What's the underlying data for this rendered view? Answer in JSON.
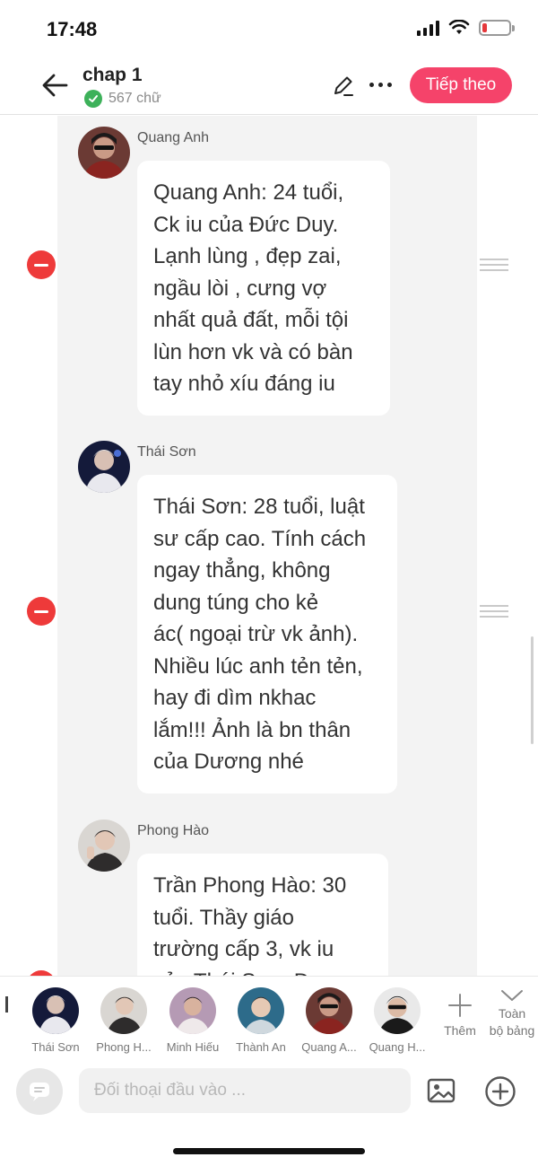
{
  "status_bar": {
    "time": "17:48",
    "battery_level": 0.15
  },
  "header": {
    "chapter_title": "chap 1",
    "word_count": "567 chữ",
    "next_label": "Tiếp theo",
    "accent_color": "#f5436a"
  },
  "messages": [
    {
      "speaker": "Quang Anh",
      "text": "Quang Anh: 24 tuổi,\nCk iu của Đức Duy.\nLạnh lùng , đẹp zai,\nngầu lòi , cưng vợ\nnhất quả đất, mỗi tội\nlùn hơn vk và có bàn\ntay nhỏ xíu đáng iu"
    },
    {
      "speaker": "Thái Sơn",
      "text": "Thái Sơn: 28 tuổi, luật\nsư cấp cao. Tính cách\nngay thẳng, không\ndung túng cho kẻ\nác( ngoại trừ vk ảnh).\nNhiều lúc anh tẻn tẻn,\nhay đi dìm nkhac\nlắm!!! Ảnh là bn thân\ncủa Dương nhé"
    },
    {
      "speaker": "Phong Hào",
      "text": "Trần Phong Hào: 30\ntuổi. Thầy giáo\ntrường cấp 3, vk iu\ncủa Thái Sơn. D..."
    }
  ],
  "characters": [
    {
      "label": "Thái Sơn"
    },
    {
      "label": "Phong H..."
    },
    {
      "label": "Minh Hiếu"
    },
    {
      "label": "Thành An"
    },
    {
      "label": "Quang A..."
    },
    {
      "label": "Quang H..."
    }
  ],
  "character_bar": {
    "add_label": "Thêm",
    "full_board_label": "Toàn\nbộ bảng"
  },
  "input_bar": {
    "placeholder": "Đối thoại đầu vào ..."
  }
}
